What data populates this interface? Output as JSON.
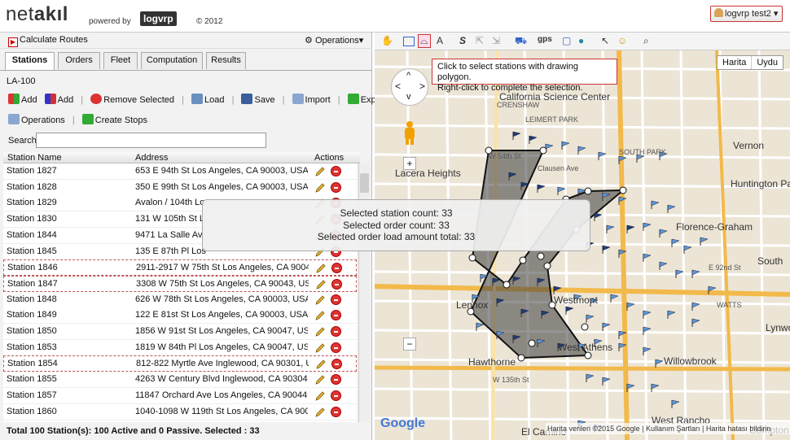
{
  "app": {
    "logo_main": "net",
    "logo_bold": "akıl",
    "powered_by": "powered by",
    "brand": "logvrp",
    "copyright": "© 2012",
    "user_button": "logvrp test2"
  },
  "left": {
    "calc_routes": "Calculate Routes",
    "operations_menu": "Operations",
    "tabs": [
      "Stations",
      "Orders",
      "Fleet",
      "Computation",
      "Results"
    ],
    "group_label": "LA-100",
    "toolbar1": [
      "Add",
      "Add",
      "Remove Selected",
      "Load",
      "Save",
      "Import",
      "Export"
    ],
    "toolbar2": [
      "Operations",
      "Create Stops"
    ],
    "search_label": "Search",
    "search_value": "",
    "headers": {
      "name": "Station Name",
      "address": "Address",
      "actions": "Actions"
    },
    "rows": [
      {
        "name": "Station 1827",
        "address": "653 E 94th St Los Angeles, CA 90003, USA",
        "selected": false
      },
      {
        "name": "Station 1828",
        "address": "350 E 99th St Los Angeles, CA 90003, USA",
        "selected": false
      },
      {
        "name": "Station 1829",
        "address": "Avalon / 104th Lo",
        "selected": false
      },
      {
        "name": "Station 1830",
        "address": "131 W 105th St L",
        "selected": false
      },
      {
        "name": "Station 1844",
        "address": "9471 La Salle Av",
        "selected": false
      },
      {
        "name": "Station 1845",
        "address": "135 E 87th Pl Los",
        "selected": false
      },
      {
        "name": "Station 1846",
        "address": "2911-2917 W 75th St Los Angeles, CA 9004...",
        "selected": true
      },
      {
        "name": "Station 1847",
        "address": "3308 W 75th St Los Angeles, CA 90043, USA",
        "selected": true
      },
      {
        "name": "Station 1848",
        "address": "626 W 78th St Los Angeles, CA 90003, USA",
        "selected": false
      },
      {
        "name": "Station 1849",
        "address": "122 E 81st St Los Angeles, CA 90003, USA",
        "selected": false
      },
      {
        "name": "Station 1850",
        "address": "1856 W 91st St Los Angeles, CA 90047, USA",
        "selected": false
      },
      {
        "name": "Station 1853",
        "address": "1819 W 84th Pl Los Angeles, CA 90047, USA",
        "selected": false
      },
      {
        "name": "Station 1854",
        "address": "812-822 Myrtle Ave Inglewood, CA 90301, U...",
        "selected": true
      },
      {
        "name": "Station 1855",
        "address": "4263 W Century Blvd Inglewood, CA 90304, ...",
        "selected": false
      },
      {
        "name": "Station 1857",
        "address": "11847 Orchard Ave Los Angeles, CA 90044, ...",
        "selected": false
      },
      {
        "name": "Station 1860",
        "address": "1040-1098 W 119th St Los Angeles, CA 900...",
        "selected": false
      }
    ],
    "footer": "Total 100 Station(s): 100 Active and 0 Passive. Selected : 33"
  },
  "map": {
    "tooltip_line1": "Click to select stations with drawing polygon.",
    "tooltip_line2": "Right-click to complete the selection.",
    "map_type": [
      "Harita",
      "Uydu"
    ],
    "overlay": {
      "station_count": "Selected station count: 33",
      "order_count": "Selected order count: 33",
      "load_total": "Selected order load amount total: 33"
    },
    "labels": [
      "California Science Center",
      "CRENSHAW",
      "LEIMERT PARK",
      "SOUTH PARK",
      "Vernon",
      "Lacera Heights",
      "Huntington Park",
      "Florence-Graham",
      "South",
      "Lennox",
      "Westmont",
      "West Athens",
      "Hawthorne",
      "Willowbrook",
      "Lynwood",
      "West Rancho",
      "Compton",
      "El Camino",
      "WATTS",
      "W 54th St",
      "W 135th St",
      "E 92nd St",
      "Clausen Ave"
    ],
    "attribution": "Harita verileri ©2015 Google | Kullanım Şartları | Harita hatası bildirin",
    "google": "Google",
    "zoom_in": "+",
    "zoom_out": "−",
    "gps": "gps"
  }
}
